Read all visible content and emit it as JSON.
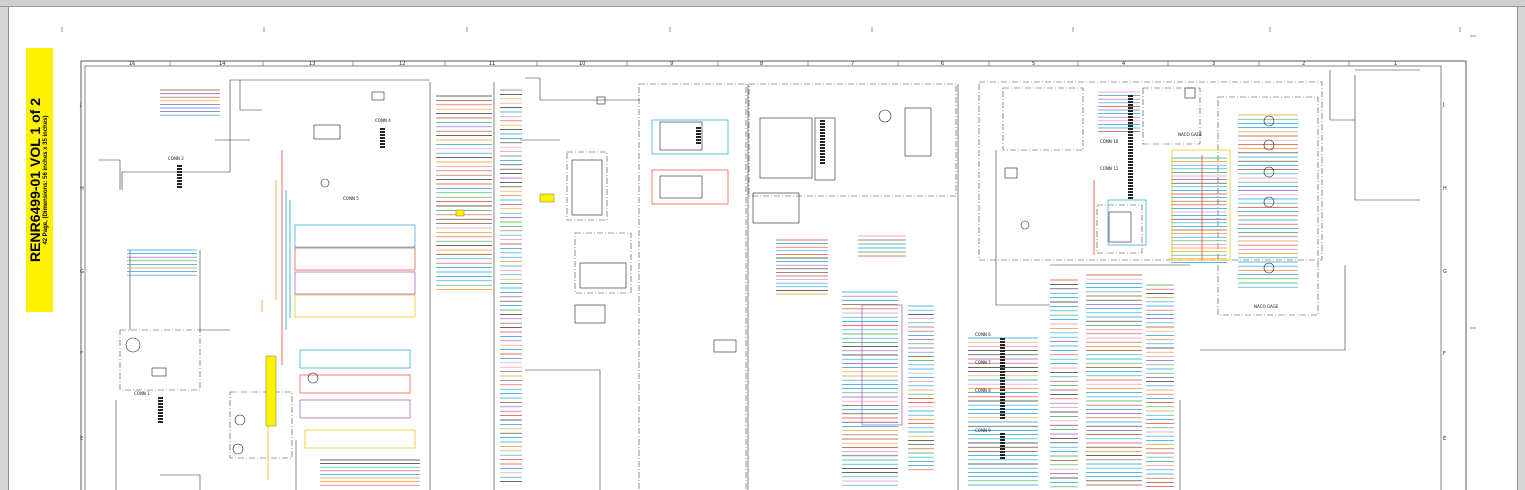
{
  "document": {
    "title": "RENR6499-01 VOL 1 of 2",
    "subtitle": "42 Page, (Dimensions: 56 inches x 35 inches)"
  },
  "grid": {
    "columns": [
      "16",
      "14",
      "13",
      "12",
      "11",
      "10",
      "9",
      "8",
      "7",
      "6",
      "5",
      "4",
      "3",
      "2",
      "1"
    ],
    "rows": [
      "J",
      "H",
      "G",
      "F",
      "E"
    ]
  },
  "labels": {
    "conn2": "CONN 2",
    "conn1": "CONN 1",
    "conn4": "CONN 4",
    "conn5": "CONN 5",
    "conn6": "CONN 6",
    "conn7": "CONN 7",
    "conn8": "CONN 8",
    "conn9": "CONN 9",
    "conn10": "CONN 10",
    "conn11": "CONN 11",
    "naco1": "NACO GAGE",
    "naco2": "NACO GAGE"
  },
  "colors": {
    "highlight": "#fff200",
    "wire_red": "#e8463a",
    "wire_blue": "#1ea2dc",
    "wire_orange": "#f29a2e",
    "wire_purple": "#9b59b6",
    "wire_yellow": "#e6c200",
    "wire_brown": "#a0522d",
    "wire_pink": "#f08fb8",
    "wire_green": "#3caa50"
  }
}
